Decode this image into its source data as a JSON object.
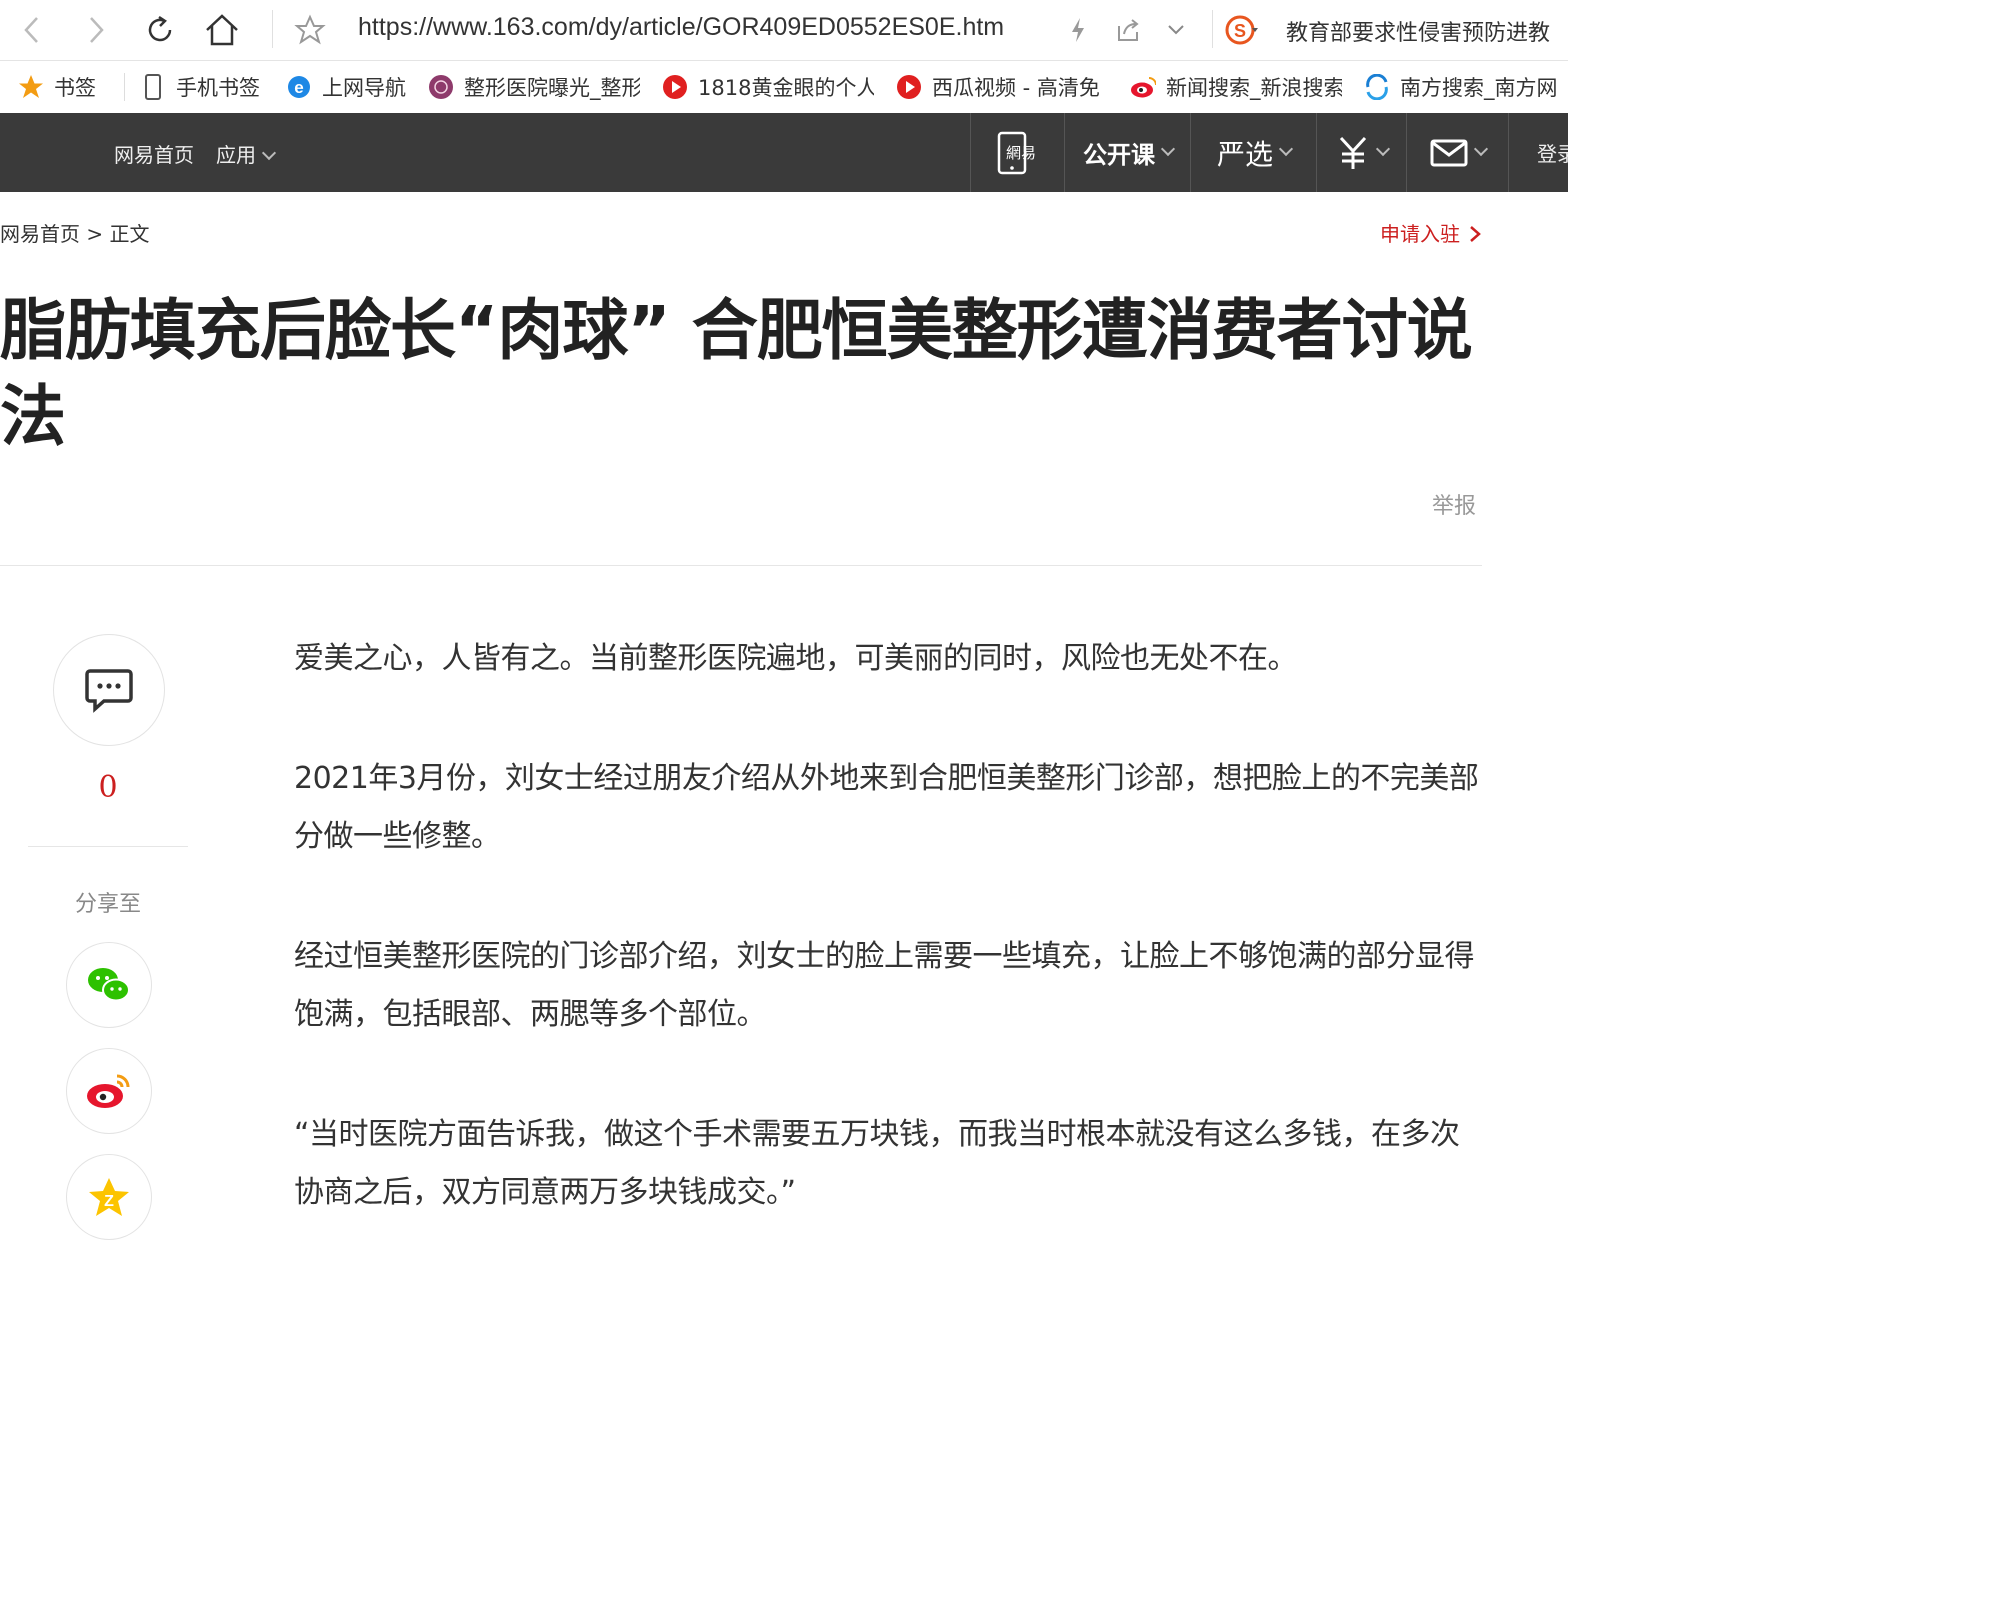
{
  "browser": {
    "url": "https://www.163.com/dy/article/GOR409ED0552ES0E.htm",
    "search_text": "教育部要求性侵害预防进教"
  },
  "bookmarks": [
    {
      "label": "书签",
      "icon": "star-icon"
    },
    {
      "label": "手机书签",
      "icon": "phone-icon"
    },
    {
      "label": "上网导航",
      "icon": "ie-icon"
    },
    {
      "label": "整形医院曝光_整形",
      "icon": "clinic-logo-icon"
    },
    {
      "label": "1818黄金眼的个人",
      "icon": "video-play-icon"
    },
    {
      "label": "西瓜视频 - 高清免",
      "icon": "video-play-icon"
    },
    {
      "label": "新闻搜索_新浪搜索",
      "icon": "weibo-icon"
    },
    {
      "label": "南方搜索_南方网",
      "icon": "southcn-icon"
    }
  ],
  "nav": {
    "home": "网易首页",
    "apps": "应用",
    "open_course": "公开课",
    "yanxuan": "严选",
    "login": "登录"
  },
  "breadcrumb": "网易首页 > 正文",
  "apply": "申请入驻",
  "article": {
    "title": "脂肪填充后脸长“肉球” 合肥恒美整形遭消费者讨说法",
    "report": "举报",
    "paragraphs": [
      "爱美之心，人皆有之。当前整形医院遍地，可美丽的同时，风险也无处不在。",
      "2021年3月份，刘女士经过朋友介绍从外地来到合肥恒美整形门诊部，想把脸上的不完美部分做一些修整。",
      "经过恒美整形医院的门诊部介绍，刘女士的脸上需要一些填充，让脸上不够饱满的部分显得饱满，包括眼部、两腮等多个部位。",
      "“当时医院方面告诉我，做这个手术需要五万块钱，而我当时根本就没有这么多钱，在多次协商之后，双方同意两万多块钱成交。”"
    ]
  },
  "sidebar": {
    "comment_count": "0",
    "share_label": "分享至"
  },
  "colors": {
    "accent": "#cc1f1f",
    "nav_bg": "#3a3a3a"
  }
}
